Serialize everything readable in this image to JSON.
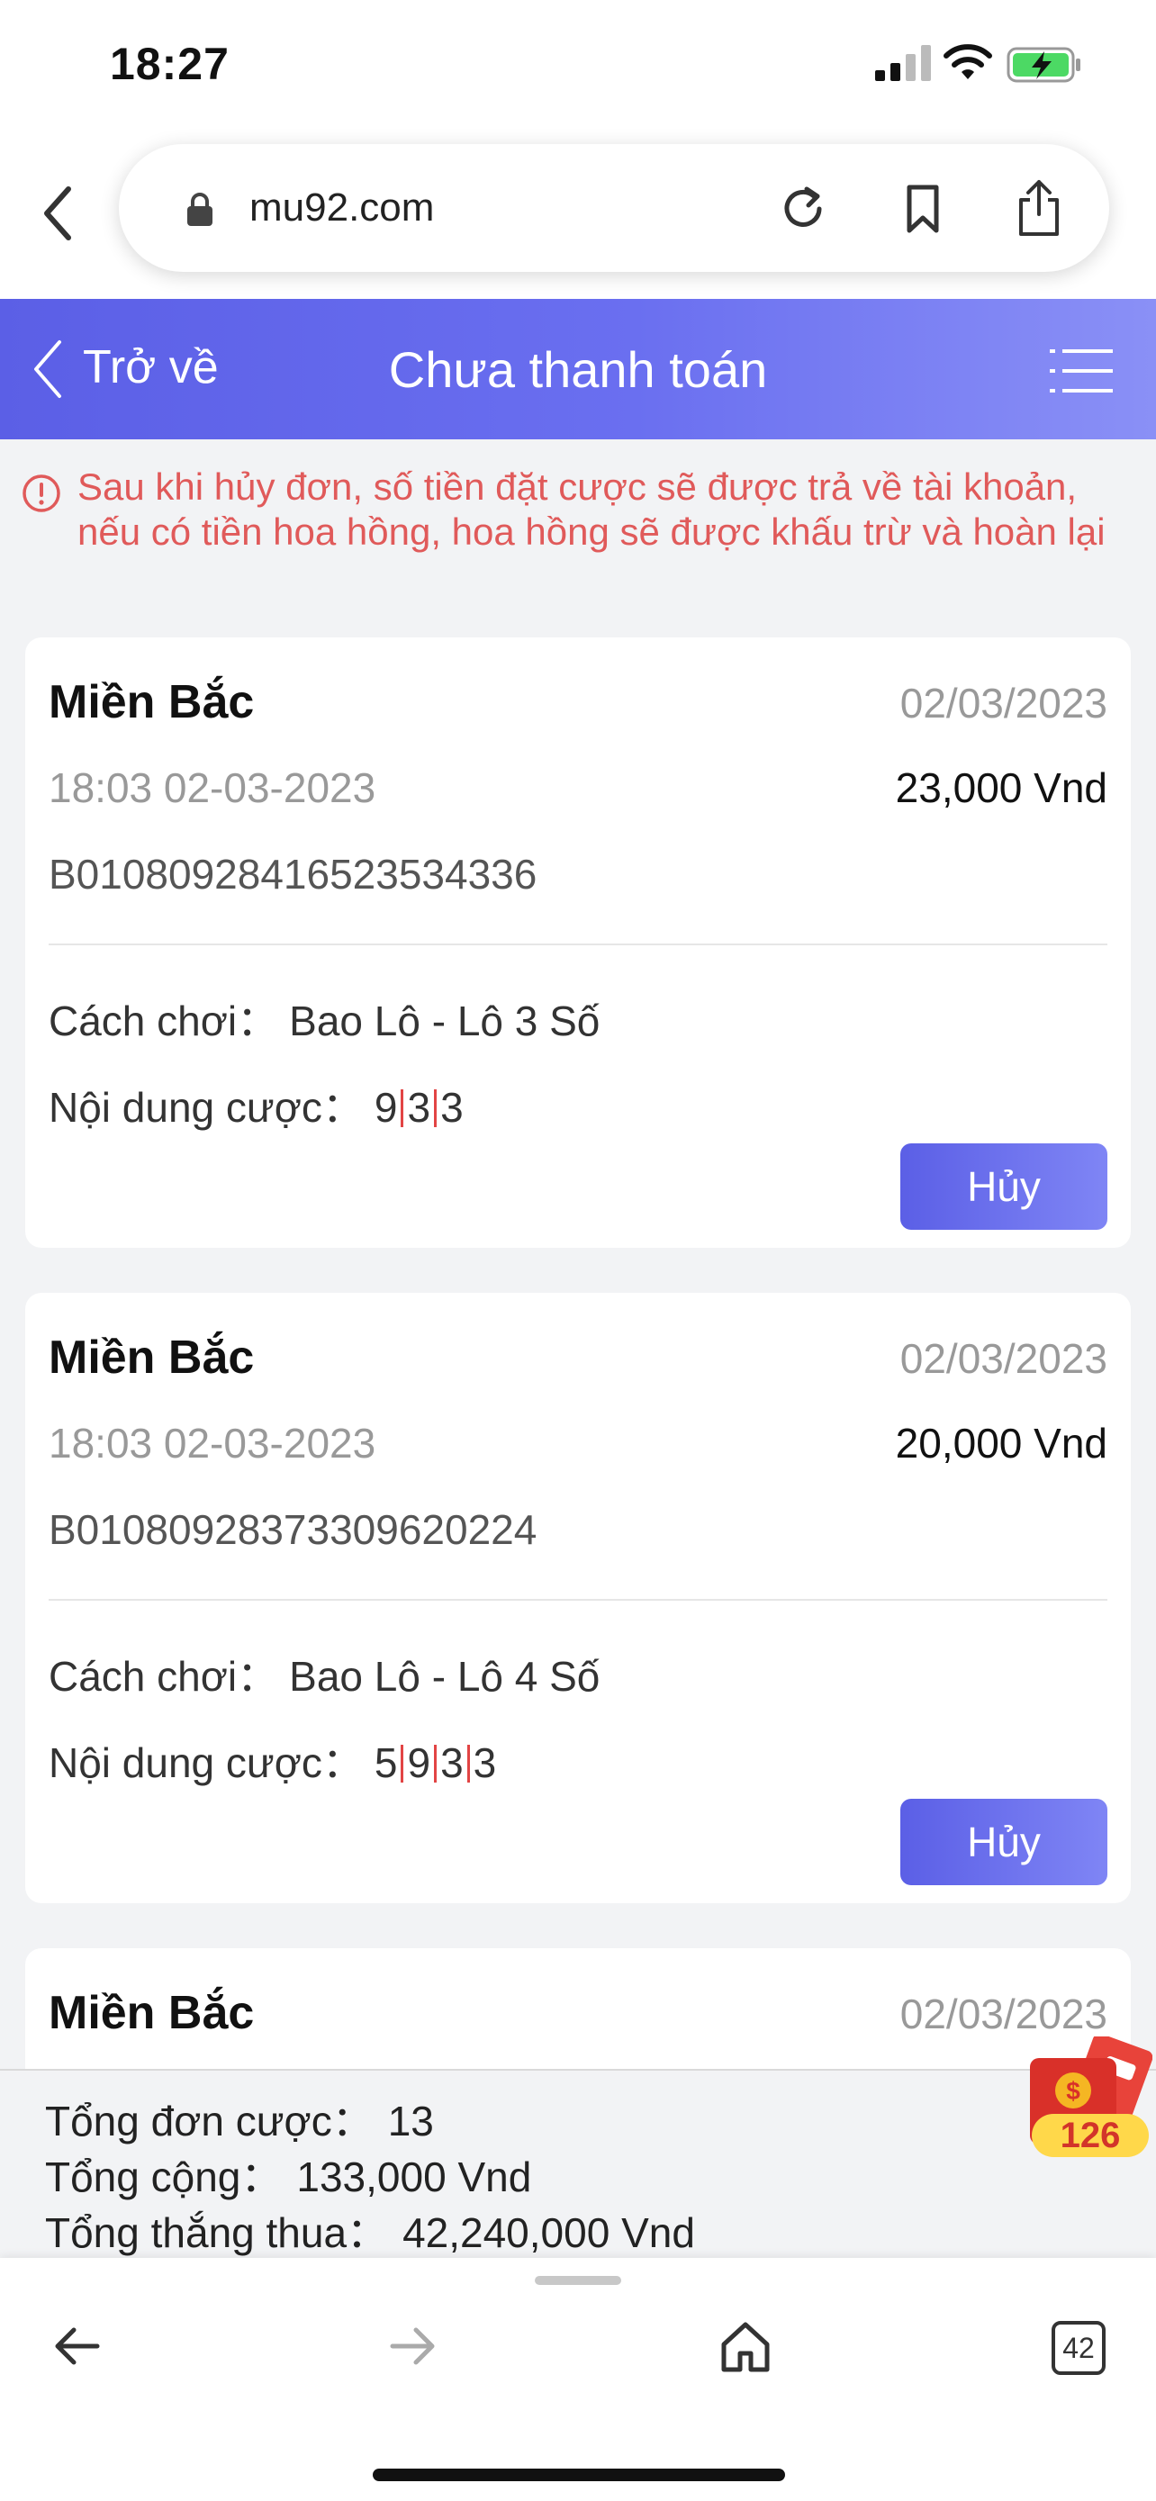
{
  "status_bar": {
    "time": "18:27"
  },
  "browser": {
    "url": "mu92.com",
    "tab_count": "42"
  },
  "header": {
    "back_label": "Trở về",
    "title": "Chưa thanh toán"
  },
  "notice": "Sau khi hủy đơn, số tiền đặt cược sẽ được trả về tài khoản, nếu có tiền hoa hồng, hoa hồng sẽ được khấu trừ và hoàn lại",
  "labels": {
    "play_method": "Cách chơi：",
    "bet_content": "Nội dung cược：",
    "cancel": "Hủy"
  },
  "orders": [
    {
      "region": "Miền Bắc",
      "date": "02/03/2023",
      "time": "18:03 02-03-2023",
      "amount": "23,000 Vnd",
      "code": "B01080928416523534336",
      "play_method": "Bao Lô - Lô 3 Số",
      "numbers": [
        "9",
        "3",
        "3"
      ]
    },
    {
      "region": "Miền Bắc",
      "date": "02/03/2023",
      "time": "18:03 02-03-2023",
      "amount": "20,000 Vnd",
      "code": "B01080928373309620224",
      "play_method": "Bao Lô - Lô 4 Số",
      "numbers": [
        "5",
        "9",
        "3",
        "3"
      ]
    },
    {
      "region": "Miền Bắc",
      "date": "02/03/2023"
    }
  ],
  "summary": {
    "total_orders_label": "Tổng đơn cược：",
    "total_orders": "13",
    "total_label": "Tổng cộng：",
    "total": "133,000 Vnd",
    "win_loss_label": "Tổng thắng thua：",
    "win_loss": "42,240,000 Vnd"
  },
  "red_envelope": {
    "count": "126"
  },
  "colors": {
    "accent": "#5b5fe6",
    "notice": "#e05a5a",
    "separator": "#e24444"
  }
}
